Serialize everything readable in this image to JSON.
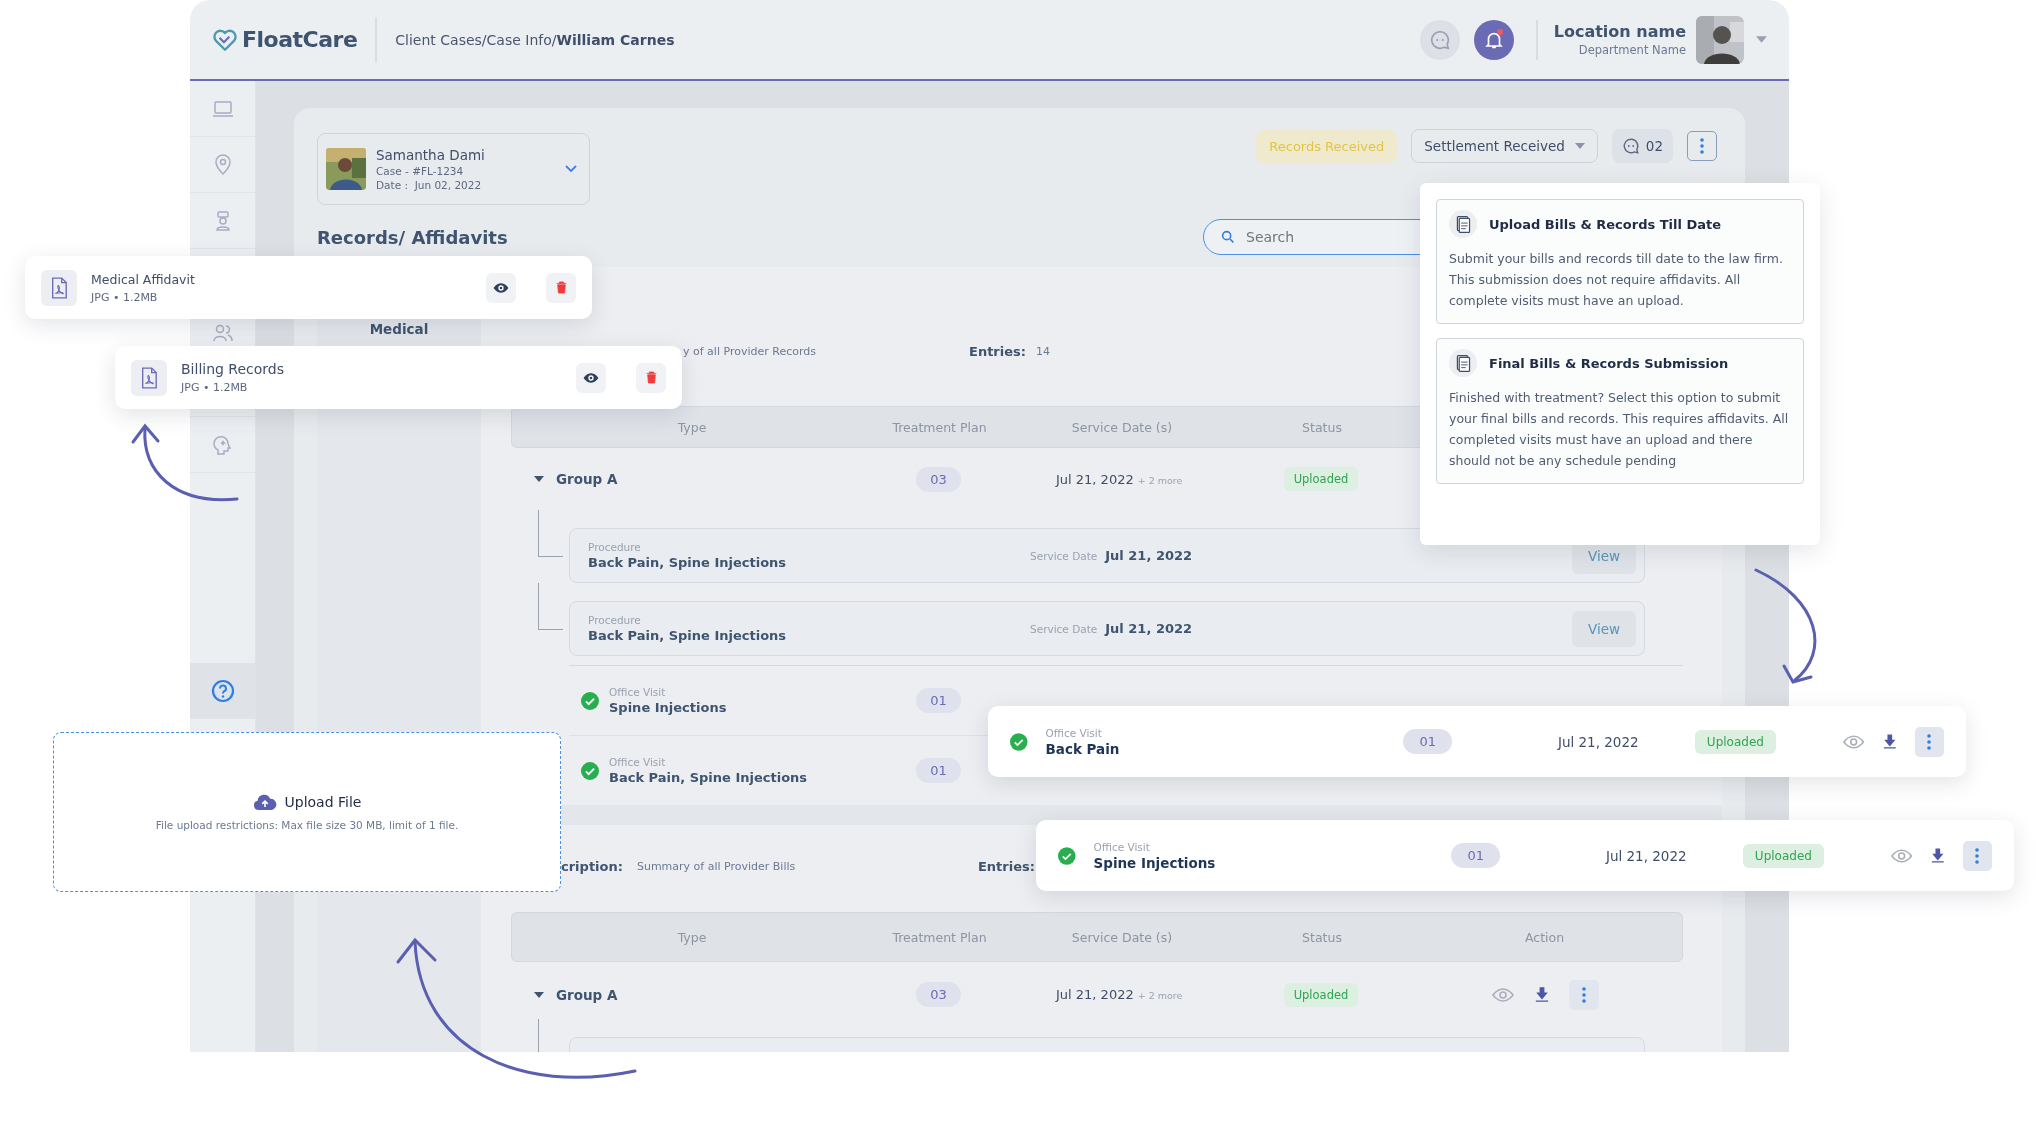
{
  "header": {
    "logo": "FloatCare",
    "breadcrumb": "Client Cases/Case Info/**William Carnes**",
    "bell_unread": true,
    "location": "Location name",
    "department": "Department Name"
  },
  "sidebar": {
    "help": {
      "selected": true
    }
  },
  "case": {
    "name": "Samantha Dami",
    "case_no": "Case - #FL-1234",
    "date_label": "Date :",
    "date": "Jun 02, 2022"
  },
  "status_badge": "Records Received",
  "status_dropdown": "Settlement Received",
  "comments": "02",
  "search": {
    "placeholder": "Search"
  },
  "section_title": "Records/ Affidavits",
  "tab": "Medical",
  "records": {
    "description": "y of all Provider Records",
    "entries_label": "Entries:",
    "entries": "14",
    "columns": [
      "Type",
      "Treatment Plan",
      "Service Date (s)",
      "Status"
    ],
    "group": {
      "name": "Group A",
      "expanded": true,
      "plan": "03",
      "date": "Jul 21, 2022",
      "more": "+ 2 more",
      "status": "Uploaded"
    },
    "procedures": [
      {
        "label": "Procedure",
        "name": "Back Pain, Spine Injections",
        "date_label": "Service Date",
        "date": "Jul 21, 2022",
        "action": "View"
      },
      {
        "label": "Procedure",
        "name": "Back Pain, Spine Injections",
        "date_label": "Service Date",
        "date": "Jul 21, 2022",
        "action": "View"
      }
    ],
    "visits": [
      {
        "label": "Office Visit",
        "name": "Spine Injections",
        "plan": "01",
        "done": true
      },
      {
        "label": "Office Visit",
        "name": "Back Pain, Spine Injections",
        "plan": "01",
        "done": true
      }
    ]
  },
  "bills": {
    "description_label": "cription:",
    "description": "Summary of all Provider Bills",
    "entries_label": "Entries:",
    "columns": [
      "Type",
      "Treatment Plan",
      "Service Date (s)",
      "Status",
      "Action"
    ],
    "group": {
      "name": "Group A",
      "expanded": true,
      "plan": "03",
      "date": "Jul 21, 2022",
      "more": "+ 2 more",
      "status": "Uploaded"
    }
  },
  "options": [
    {
      "title": "Upload Bills & Records Till Date",
      "text": "Submit your bills and records till date to the law firm. This submission does not require affidavits. All complete visits must have an upload."
    },
    {
      "title": "Final Bills & Records Submission",
      "text": "Finished with treatment? Select this option to submit your final bills and records. This requires affidavits. All completed visits must have an upload and there should not be any schedule pending"
    }
  ],
  "files": [
    {
      "name": "Medical Affidavit",
      "meta": "JPG • 1.2MB"
    },
    {
      "name": "Billing Records",
      "meta": "JPG • 1.2MB"
    }
  ],
  "visit_cards": [
    {
      "label": "Office Visit",
      "name": "Back Pain",
      "plan": "01",
      "date": "Jul 21, 2022",
      "status": "Uploaded",
      "done": true
    },
    {
      "label": "Office Visit",
      "name": "Spine Injections",
      "plan": "01",
      "date": "Jul 21, 2022",
      "status": "Uploaded",
      "done": true
    }
  ],
  "upload": {
    "title": "Upload File",
    "note": "File upload restrictions: Max file size 30 MB, limit of 1 file."
  }
}
